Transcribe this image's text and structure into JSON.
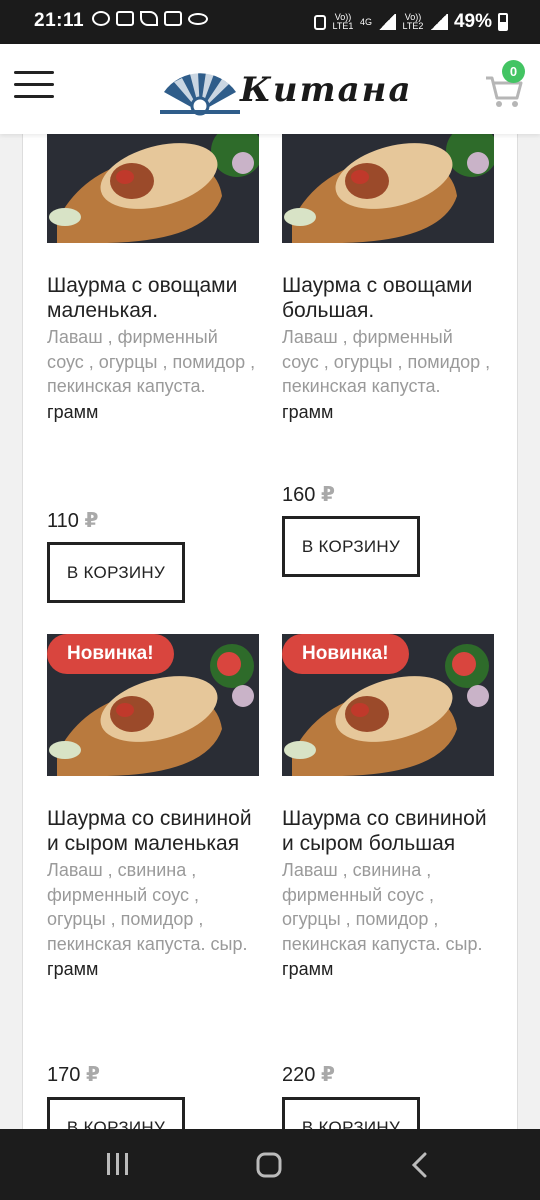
{
  "status_bar": {
    "time": "21:11",
    "battery": "49%",
    "net1": "Vo)) LTE1",
    "net2": "4G",
    "net3": "Vo)) LTE2"
  },
  "header": {
    "logo_text": "Китана",
    "cart_count": "0"
  },
  "products": [
    {
      "badge": "",
      "title": "Шаурма с овощами маленькая.",
      "description": "Лаваш , фирменный соус , огурцы , помидор , пекинская капуста.",
      "weight": "грамм",
      "price": "110",
      "currency": "₽",
      "button": "В КОРЗИНУ"
    },
    {
      "badge": "",
      "title": "Шаурма с овощами большая.",
      "description": "Лаваш , фирменный соус , огурцы , помидор , пекинская капуста.",
      "weight": "грамм",
      "price": "160",
      "currency": "₽",
      "button": "В КОРЗИНУ"
    },
    {
      "badge": "Новинка!",
      "title": "Шаурма со свининой и сыром маленькая",
      "description": "Лаваш , свинина , фирменный соус , огурцы , помидор , пекинская капуста. сыр.",
      "weight": "грамм",
      "price": "170",
      "currency": "₽",
      "button": "В КОРЗИНУ"
    },
    {
      "badge": "Новинка!",
      "title": "Шаурма со свининой и сыром большая",
      "description": "Лаваш , свинина , фирменный соус , огурцы , помидор , пекинская капуста. сыр.",
      "weight": "грамм",
      "price": "220",
      "currency": "₽",
      "button": "В КОРЗИНУ"
    }
  ],
  "colors": {
    "badge": "#d9453e",
    "cart_badge": "#43c463",
    "logo_blue": "#2f5d8a"
  },
  "icons": {
    "menu": "hamburger-icon",
    "cart": "cart-icon",
    "nav_recent": "recent-apps-icon",
    "nav_home": "home-icon",
    "nav_back": "back-icon"
  }
}
